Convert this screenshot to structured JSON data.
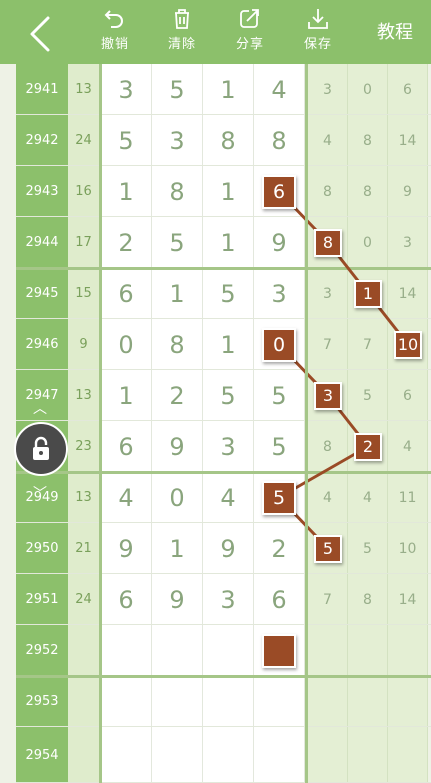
{
  "header": {
    "toolbar": [
      {
        "id": "undo",
        "label": "撤销",
        "icon": "undo-icon"
      },
      {
        "id": "clear",
        "label": "清除",
        "icon": "trash-icon"
      },
      {
        "id": "share",
        "label": "分享",
        "icon": "share-icon"
      },
      {
        "id": "save",
        "label": "保存",
        "icon": "download-icon"
      }
    ],
    "tutorial_label": "教程"
  },
  "rows": [
    {
      "issue": "2941",
      "sum": "13",
      "digits": [
        "3",
        "5",
        "1",
        "4"
      ],
      "trail": [
        "3",
        "0",
        "6"
      ]
    },
    {
      "issue": "2942",
      "sum": "24",
      "digits": [
        "5",
        "3",
        "8",
        "8"
      ],
      "trail": [
        "4",
        "8",
        "14"
      ]
    },
    {
      "issue": "2943",
      "sum": "16",
      "digits": [
        "1",
        "8",
        "1",
        "6"
      ],
      "trail": [
        "8",
        "8",
        "9"
      ]
    },
    {
      "issue": "2944",
      "sum": "17",
      "digits": [
        "2",
        "5",
        "1",
        "9"
      ],
      "trail": [
        "8",
        "0",
        "3"
      ]
    },
    {
      "issue": "2945",
      "sum": "15",
      "digits": [
        "6",
        "1",
        "5",
        "3"
      ],
      "trail": [
        "3",
        "1",
        "14"
      ]
    },
    {
      "issue": "2946",
      "sum": "9",
      "digits": [
        "0",
        "8",
        "1",
        "0"
      ],
      "trail": [
        "7",
        "7",
        "10"
      ]
    },
    {
      "issue": "2947",
      "sum": "13",
      "digits": [
        "1",
        "2",
        "5",
        "5"
      ],
      "trail": [
        "3",
        "5",
        "6"
      ]
    },
    {
      "issue": "",
      "sum": "23",
      "digits": [
        "6",
        "9",
        "3",
        "5"
      ],
      "trail": [
        "8",
        "2",
        "4"
      ]
    },
    {
      "issue": "2949",
      "sum": "13",
      "digits": [
        "4",
        "0",
        "4",
        "5"
      ],
      "trail": [
        "4",
        "4",
        "11"
      ]
    },
    {
      "issue": "2950",
      "sum": "21",
      "digits": [
        "9",
        "1",
        "9",
        "2"
      ],
      "trail": [
        "5",
        "5",
        "10"
      ]
    },
    {
      "issue": "2951",
      "sum": "24",
      "digits": [
        "6",
        "9",
        "3",
        "6"
      ],
      "trail": [
        "7",
        "8",
        "14"
      ]
    },
    {
      "issue": "2952",
      "sum": "",
      "digits": [
        "",
        "",
        "",
        ""
      ],
      "trail": [
        "",
        "",
        ""
      ]
    },
    {
      "issue": "2953",
      "sum": "",
      "digits": [
        "",
        "",
        "",
        ""
      ],
      "trail": [
        "",
        "",
        ""
      ]
    },
    {
      "issue": "2954",
      "sum": "",
      "digits": [
        "",
        "",
        "",
        ""
      ],
      "trail": [
        "",
        "",
        ""
      ]
    }
  ],
  "highlights": [
    {
      "row": 2,
      "col": "d3",
      "value": "6"
    },
    {
      "row": 3,
      "col": "t0",
      "value": "8"
    },
    {
      "row": 4,
      "col": "t1",
      "value": "1"
    },
    {
      "row": 5,
      "col": "t2",
      "value": "10"
    },
    {
      "row": 5,
      "col": "d3",
      "value": "0"
    },
    {
      "row": 6,
      "col": "t0",
      "value": "3"
    },
    {
      "row": 7,
      "col": "t1",
      "value": "2"
    },
    {
      "row": 8,
      "col": "d3",
      "value": "5"
    },
    {
      "row": 9,
      "col": "t0",
      "value": "5"
    },
    {
      "row": 11,
      "col": "d3",
      "value": ""
    }
  ],
  "colors": {
    "header": "#8cc06b",
    "badge": "#9a4b26",
    "line": "#9a4b26"
  }
}
